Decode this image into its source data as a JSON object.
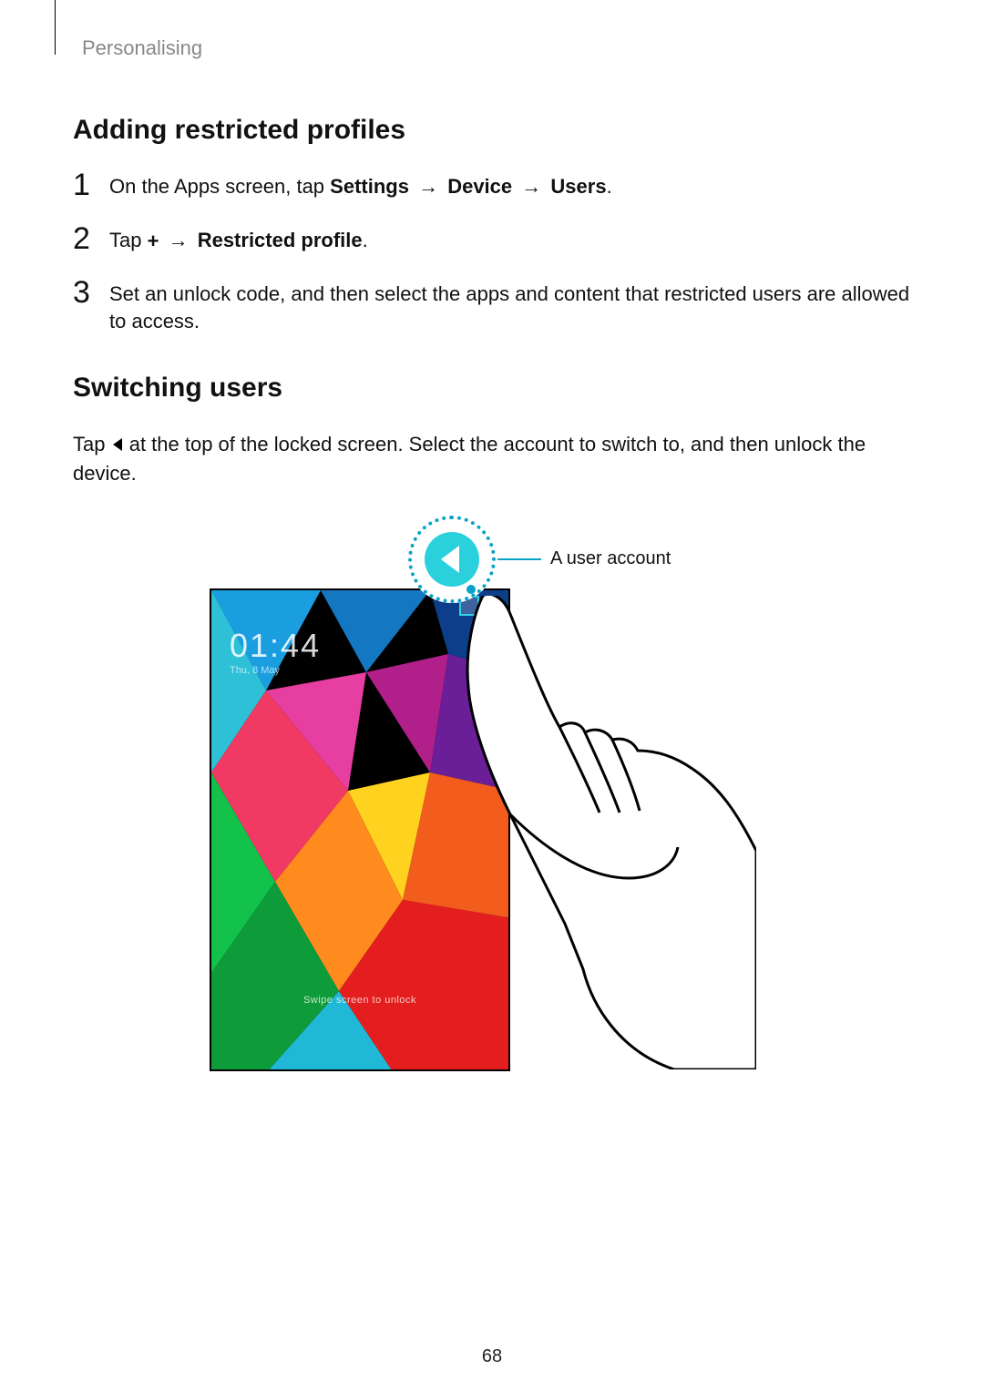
{
  "header": {
    "section": "Personalising"
  },
  "section1": {
    "title": "Adding restricted profiles",
    "steps": {
      "s1": {
        "num": "1",
        "pre": "On the Apps screen, tap ",
        "settings": "Settings",
        "arrow1": "→",
        "device": "Device",
        "arrow2": "→",
        "users": "Users",
        "post": "."
      },
      "s2": {
        "num": "2",
        "pre": "Tap ",
        "plus": "+",
        "arrow": "→",
        "restricted": "Restricted profile",
        "post": "."
      },
      "s3": {
        "num": "3",
        "text": "Set an unlock code, and then select the apps and content that restricted users are allowed to access."
      }
    }
  },
  "section2": {
    "title": "Switching users",
    "para_pre": "Tap ",
    "para_post": " at the top of the locked screen. Select the account to switch to, and then unlock the device."
  },
  "figure": {
    "clock": "01:44",
    "clock_sub": "Thu, 8 May",
    "swipe": "Swipe screen to unlock",
    "callout": "A user account"
  },
  "page_number": "68"
}
